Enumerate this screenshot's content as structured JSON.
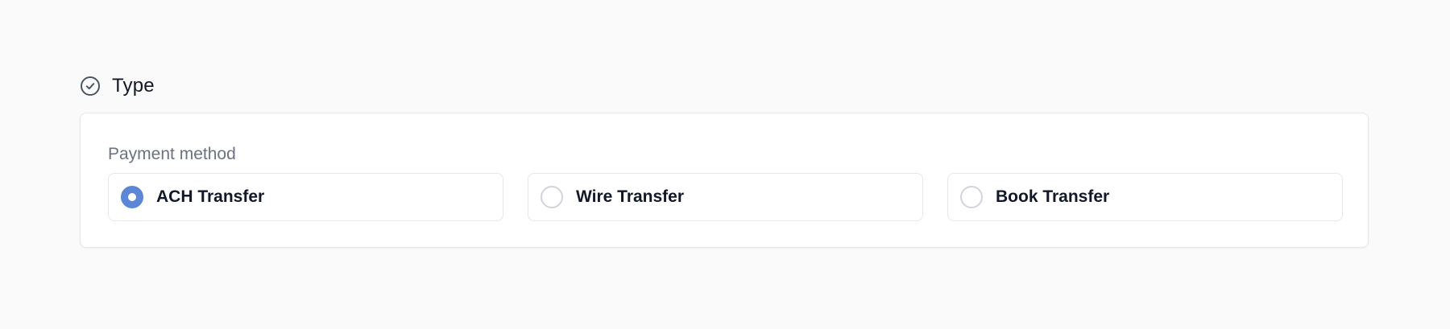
{
  "section": {
    "title": "Type",
    "icon": "check-circle-icon"
  },
  "payment": {
    "label": "Payment method",
    "selected": "ACH Transfer",
    "options": [
      {
        "label": "ACH Transfer",
        "checked": true
      },
      {
        "label": "Wire Transfer",
        "checked": false
      },
      {
        "label": "Book Transfer",
        "checked": false
      }
    ]
  },
  "colors": {
    "accent": "#5b87d6",
    "background": "#fafafa",
    "card": "#ffffff",
    "border": "#e5e7eb",
    "label": "#6b7280"
  }
}
